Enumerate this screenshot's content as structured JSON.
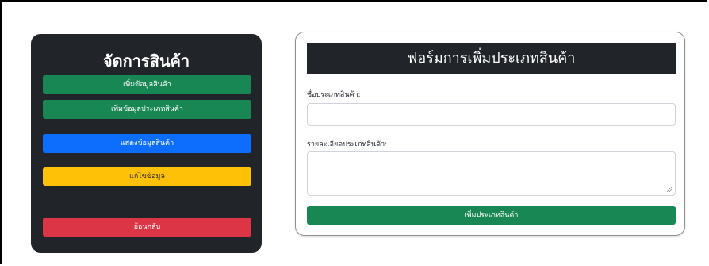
{
  "sidebar": {
    "title": "จัดการสินค้า",
    "buttons": [
      {
        "label": "เพิ่มข้อมูลสินค้า",
        "color": "#198754"
      },
      {
        "label": "เพิ่มข้อมูลประเภทสินค้า",
        "color": "#198754"
      },
      {
        "label": "แสดงข้อมูลสินค้า",
        "color": "#0d6efd"
      },
      {
        "label": "แก้ไขข้อมูล",
        "color": "#ffc107"
      },
      {
        "label": "ย้อนกลับ",
        "color": "#dc3545"
      }
    ]
  },
  "form": {
    "title": "ฟอร์มการเพิ่มประเภทสินค้า",
    "name_label": "ชื่อประเภทสินค้า:",
    "name_value": "",
    "detail_label": "รายละเอียดประเภทสินค้า:",
    "detail_value": "",
    "submit_label": "เพิ่มประเภทสินค้า"
  },
  "colors": {
    "dark": "#212529",
    "success": "#198754",
    "primary": "#0d6efd",
    "warning": "#ffc107",
    "danger": "#dc3545"
  }
}
